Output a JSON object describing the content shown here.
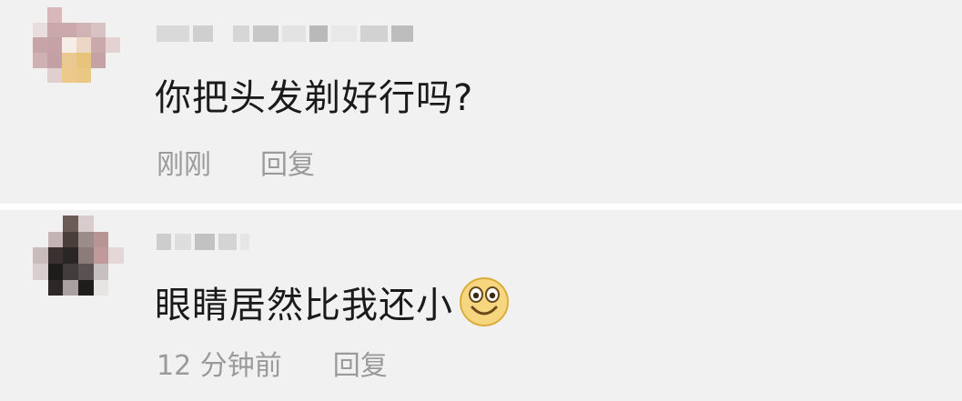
{
  "comments": [
    {
      "text": "你把头发剃好行吗?",
      "time": "刚刚",
      "reply_label": "回复"
    },
    {
      "text": "眼睛居然比我还小",
      "emoji": "smiley-face-icon",
      "time": "12 分钟前",
      "reply_label": "回复"
    }
  ],
  "colors": {
    "background": "#f1f1f1",
    "text": "#1a1a1a",
    "meta_text": "#9a9a9a",
    "emoji_face": "#f5d983"
  }
}
